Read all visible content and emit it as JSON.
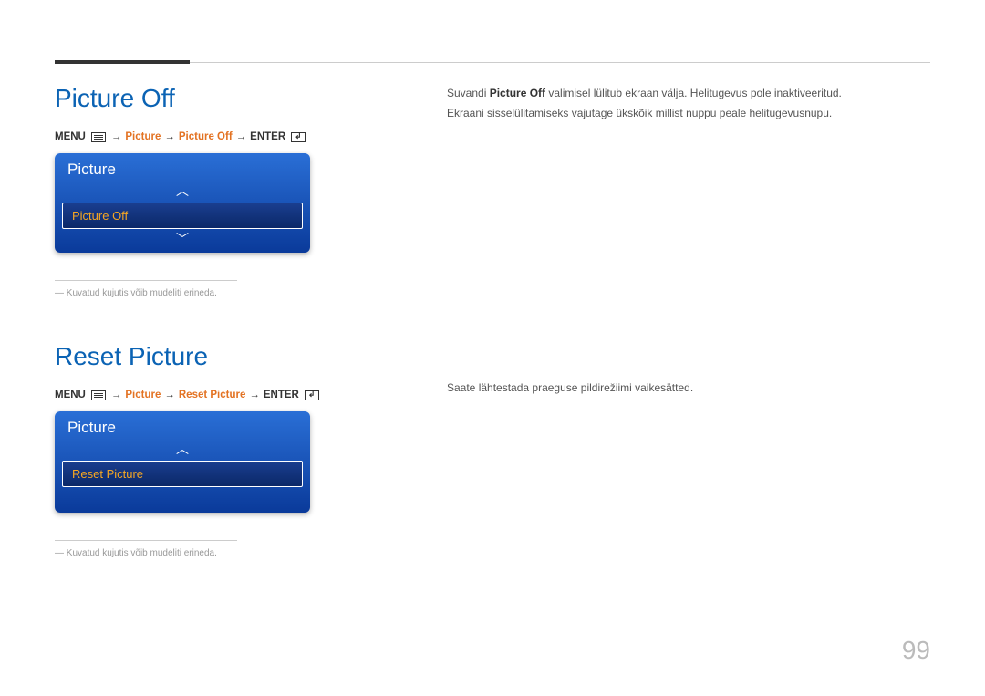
{
  "page_number": "99",
  "section1": {
    "heading": "Picture Off",
    "nav": {
      "menu_label": "MENU",
      "picture_label": "Picture",
      "target_label": "Picture Off",
      "enter_label": "ENTER",
      "arrow": "→"
    },
    "widget": {
      "title": "Picture",
      "item": "Picture Off",
      "chevron_up": "︿",
      "chevron_down": "﹀"
    },
    "note": "Kuvatud kujutis võib mudeliti erineda.",
    "body_prefix": "Suvandi ",
    "body_strong": "Picture Off",
    "body_suffix": " valimisel lülitub ekraan välja. Helitugevus pole inaktiveeritud.",
    "body_line2": "Ekraani sisselülitamiseks vajutage ükskõik millist nuppu peale helitugevusnupu."
  },
  "section2": {
    "heading": "Reset Picture",
    "nav": {
      "menu_label": "MENU",
      "picture_label": "Picture",
      "target_label": "Reset Picture",
      "enter_label": "ENTER",
      "arrow": "→"
    },
    "widget": {
      "title": "Picture",
      "item": "Reset Picture",
      "chevron_up": "︿"
    },
    "note": "Kuvatud kujutis võib mudeliti erineda.",
    "body": "Saate lähtestada praeguse pildirežiimi vaikesätted."
  }
}
